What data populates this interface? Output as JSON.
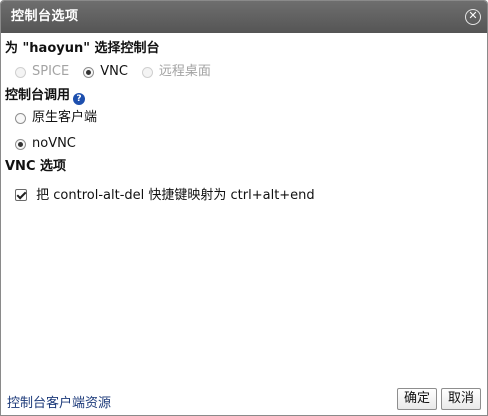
{
  "dialog": {
    "title": "控制台选项",
    "close_symbol": "✕"
  },
  "console_select": {
    "label": "为 \"haoyun\" 选择控制台",
    "options": [
      {
        "label": "SPICE",
        "checked": false,
        "disabled": true
      },
      {
        "label": "VNC",
        "checked": true,
        "disabled": false
      },
      {
        "label": "远程桌面",
        "checked": false,
        "disabled": true
      }
    ]
  },
  "console_invocation": {
    "label": "控制台调用",
    "help_symbol": "?",
    "options": [
      {
        "label": "原生客户端",
        "checked": false
      },
      {
        "label": "noVNC",
        "checked": true
      }
    ]
  },
  "vnc_options": {
    "label": "VNC 选项",
    "checkbox_label": "把 control-alt-del 快捷键映射为 ctrl+alt+end",
    "checked": true
  },
  "footer": {
    "link_label": "控制台客户端资源",
    "ok_label": "确定",
    "cancel_label": "取消"
  },
  "colors": {
    "titlebar": "#5f5f5f",
    "link": "#1c3a7a",
    "help_icon": "#1d4fae"
  }
}
